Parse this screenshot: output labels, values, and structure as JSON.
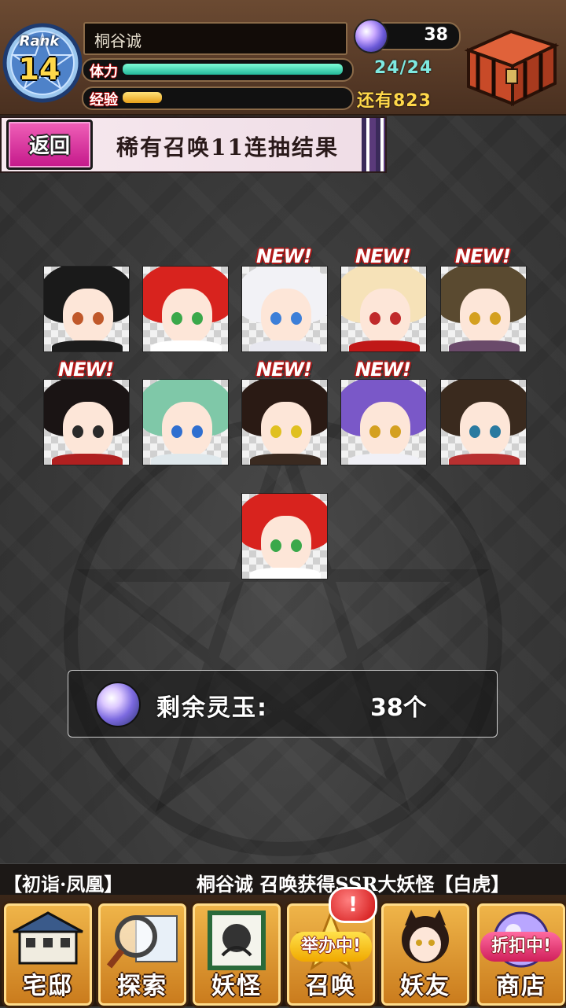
{
  "header": {
    "rank_label": "Rank",
    "rank_value": "14",
    "player_name": "桐谷诚",
    "stamina_label": "体力",
    "stamina_value": "24/24",
    "stamina_fraction": 1.0,
    "exp_label": "经验",
    "exp_remaining": "还有823",
    "exp_fraction": 0.18,
    "gem_count": "38"
  },
  "title_bar": {
    "back_label": "返回",
    "title": "稀有召唤11连抽结果"
  },
  "results": {
    "new_label": "NEW!",
    "cards": [
      {
        "name": "dark-hair-eyepatch",
        "is_new": false,
        "hair": "#1a1a1a",
        "eye": "#c0582a",
        "body": "#1c1c1c"
      },
      {
        "name": "red-hair-girl",
        "is_new": false,
        "hair": "#d8231e",
        "eye": "#3aa84a",
        "body": "#ffffff"
      },
      {
        "name": "white-hair-fox",
        "is_new": true,
        "hair": "#f2f2f6",
        "eye": "#3d7fd8",
        "body": "#e8e8f0"
      },
      {
        "name": "blonde-red-dress",
        "is_new": true,
        "hair": "#f6e2b8",
        "eye": "#c02a2a",
        "body": "#c01818"
      },
      {
        "name": "dark-green-hair",
        "is_new": true,
        "hair": "#5a4a30",
        "eye": "#d4a020",
        "body": "#6a4a6a"
      },
      {
        "name": "black-bob-kimono",
        "is_new": true,
        "hair": "#1a1414",
        "eye": "#2a2a2a",
        "body": "#b02020"
      },
      {
        "name": "green-hair-flowers",
        "is_new": false,
        "hair": "#7fc8a8",
        "eye": "#2f6fd0",
        "body": "#dfe8ec"
      },
      {
        "name": "cat-ears-yellow-eyes",
        "is_new": true,
        "hair": "#2a1a14",
        "eye": "#e0c020",
        "body": "#3a2a20"
      },
      {
        "name": "purple-hair-girl",
        "is_new": true,
        "hair": "#7a58c8",
        "eye": "#d4a020",
        "body": "#f0f0f6"
      },
      {
        "name": "brown-long-hair",
        "is_new": false,
        "hair": "#3a2a1e",
        "eye": "#2a7aa0",
        "body": "#b83030"
      },
      {
        "name": "red-hair-girl-2",
        "is_new": false,
        "hair": "#d8231e",
        "eye": "#3aa84a",
        "body": "#ffffff"
      }
    ]
  },
  "remaining": {
    "label": "剩余灵玉:",
    "count": "38个"
  },
  "ticker": {
    "left_text": "【初诣·凤凰】",
    "right_text": "桐谷诚 召唤获得SSR大妖怪【白虎】"
  },
  "nav": {
    "items": [
      {
        "id": "home",
        "label": "宅邸",
        "icon": "mansion-icon"
      },
      {
        "id": "explore",
        "label": "探索",
        "icon": "magnifier-map-icon"
      },
      {
        "id": "monsters",
        "label": "妖怪",
        "icon": "scroll-monster-icon"
      },
      {
        "id": "summon",
        "label": "召唤",
        "icon": "summon-icon",
        "tag": "举办中!"
      },
      {
        "id": "friends",
        "label": "妖友",
        "icon": "catgirl-icon"
      },
      {
        "id": "shop",
        "label": "商店",
        "icon": "crystal-orb-icon",
        "tag": "折扣中!"
      }
    ],
    "alert": "!"
  },
  "colors": {
    "accent_pink": "#d8229a",
    "stamina": "#23b99a",
    "exp": "#e8a11a",
    "new_badge": "#b01818"
  }
}
